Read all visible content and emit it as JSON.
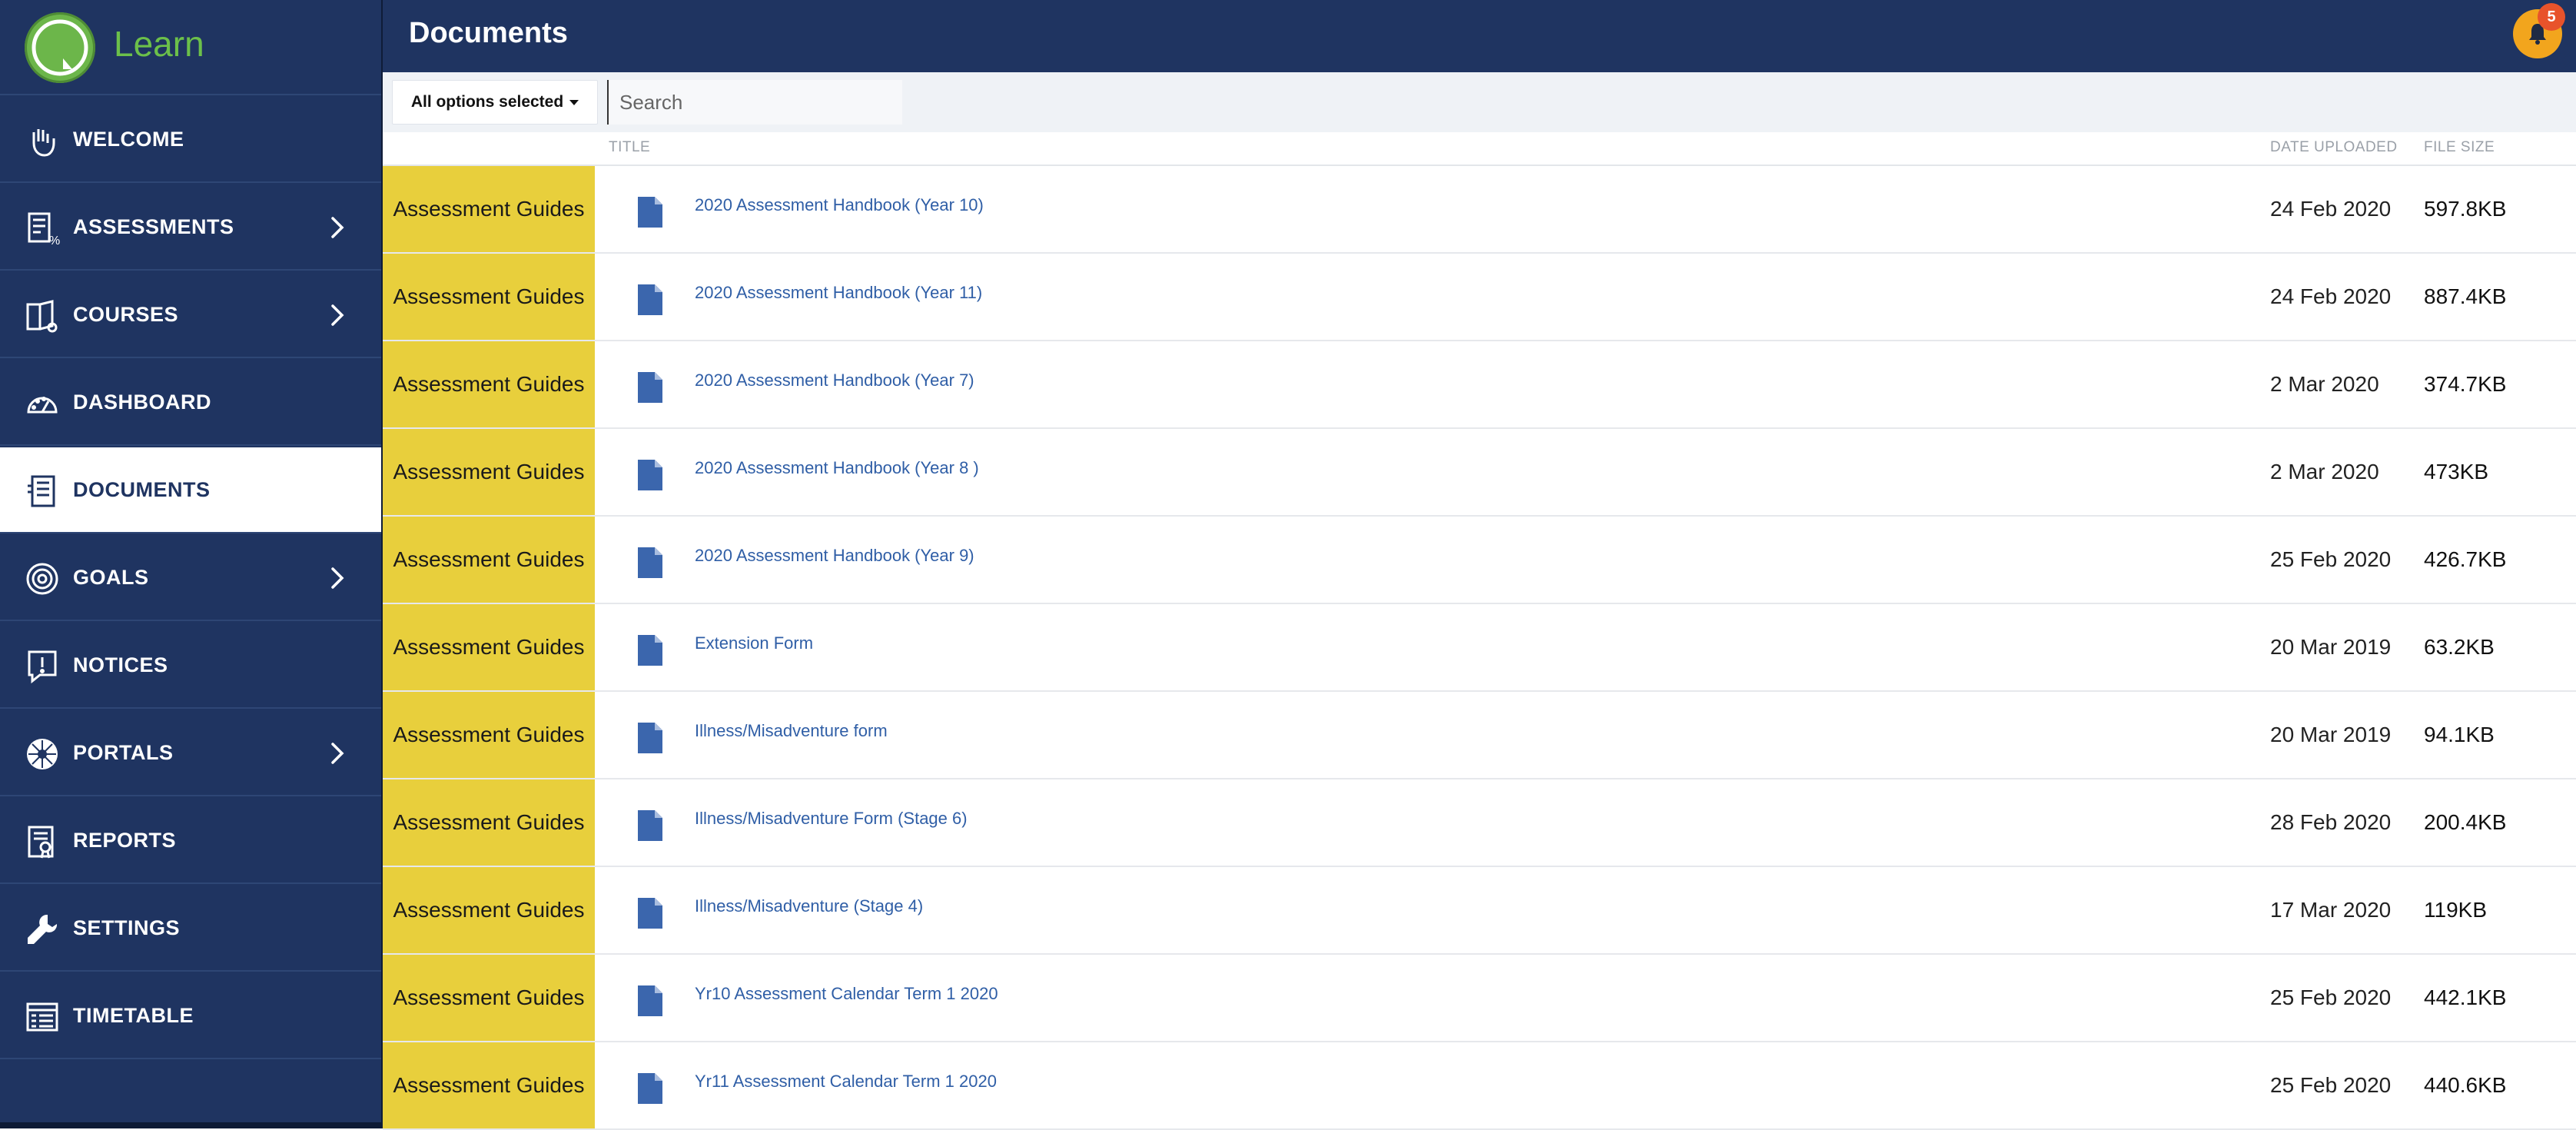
{
  "app": {
    "brand_name": "Learn"
  },
  "sidebar": {
    "items": [
      {
        "label": "WELCOME",
        "icon": "hand-icon",
        "chevron": false,
        "active": false
      },
      {
        "label": "ASSESSMENTS",
        "icon": "assessment-icon",
        "chevron": true,
        "active": false
      },
      {
        "label": "COURSES",
        "icon": "book-icon",
        "chevron": true,
        "active": false
      },
      {
        "label": "DASHBOARD",
        "icon": "gauge-icon",
        "chevron": false,
        "active": false
      },
      {
        "label": "DOCUMENTS",
        "icon": "documents-icon",
        "chevron": false,
        "active": true
      },
      {
        "label": "GOALS",
        "icon": "target-icon",
        "chevron": true,
        "active": false
      },
      {
        "label": "NOTICES",
        "icon": "notice-icon",
        "chevron": false,
        "active": false
      },
      {
        "label": "PORTALS",
        "icon": "portal-icon",
        "chevron": true,
        "active": false
      },
      {
        "label": "REPORTS",
        "icon": "report-icon",
        "chevron": false,
        "active": false
      },
      {
        "label": "SETTINGS",
        "icon": "wrench-icon",
        "chevron": false,
        "active": false
      },
      {
        "label": "TIMETABLE",
        "icon": "timetable-icon",
        "chevron": false,
        "active": false
      }
    ]
  },
  "header": {
    "title": "Documents",
    "notification_count": "5"
  },
  "filters": {
    "dropdown_label": "All options selected",
    "search_placeholder": "Search"
  },
  "table": {
    "columns": {
      "title": "TITLE",
      "date": "DATE UPLOADED",
      "size": "FILE SIZE"
    },
    "rows": [
      {
        "category": "Assessment Guides",
        "title": "2020 Assessment Handbook (Year 10)",
        "date": "24 Feb 2020",
        "size": "597.8KB"
      },
      {
        "category": "Assessment Guides",
        "title": "2020 Assessment Handbook (Year 11)",
        "date": "24 Feb 2020",
        "size": "887.4KB"
      },
      {
        "category": "Assessment Guides",
        "title": "2020 Assessment Handbook (Year 7)",
        "date": "2 Mar 2020",
        "size": "374.7KB"
      },
      {
        "category": "Assessment Guides",
        "title": "2020 Assessment Handbook (Year 8 )",
        "date": "2 Mar 2020",
        "size": "473KB"
      },
      {
        "category": "Assessment Guides",
        "title": "2020 Assessment Handbook (Year 9)",
        "date": "25 Feb 2020",
        "size": "426.7KB"
      },
      {
        "category": "Assessment Guides",
        "title": "Extension Form",
        "date": "20 Mar 2019",
        "size": "63.2KB"
      },
      {
        "category": "Assessment Guides",
        "title": "Illness/Misadventure form",
        "date": "20 Mar 2019",
        "size": "94.1KB"
      },
      {
        "category": "Assessment Guides",
        "title": "Illness/Misadventure Form (Stage 6)",
        "date": "28 Feb 2020",
        "size": "200.4KB"
      },
      {
        "category": "Assessment Guides",
        "title": "Illness/Misadventure (Stage 4)",
        "date": "17 Mar 2020",
        "size": "119KB"
      },
      {
        "category": "Assessment Guides",
        "title": "Yr10 Assessment Calendar Term 1 2020",
        "date": "25 Feb 2020",
        "size": "442.1KB"
      },
      {
        "category": "Assessment Guides",
        "title": "Yr11 Assessment Calendar Term 1 2020",
        "date": "25 Feb 2020",
        "size": "440.6KB"
      }
    ]
  },
  "colors": {
    "navy": "#1f3461",
    "category_yellow": "#e8cf3c",
    "link_blue": "#2f5ea6",
    "brand_green": "#6cc04a",
    "bell_orange": "#f2a51d"
  }
}
